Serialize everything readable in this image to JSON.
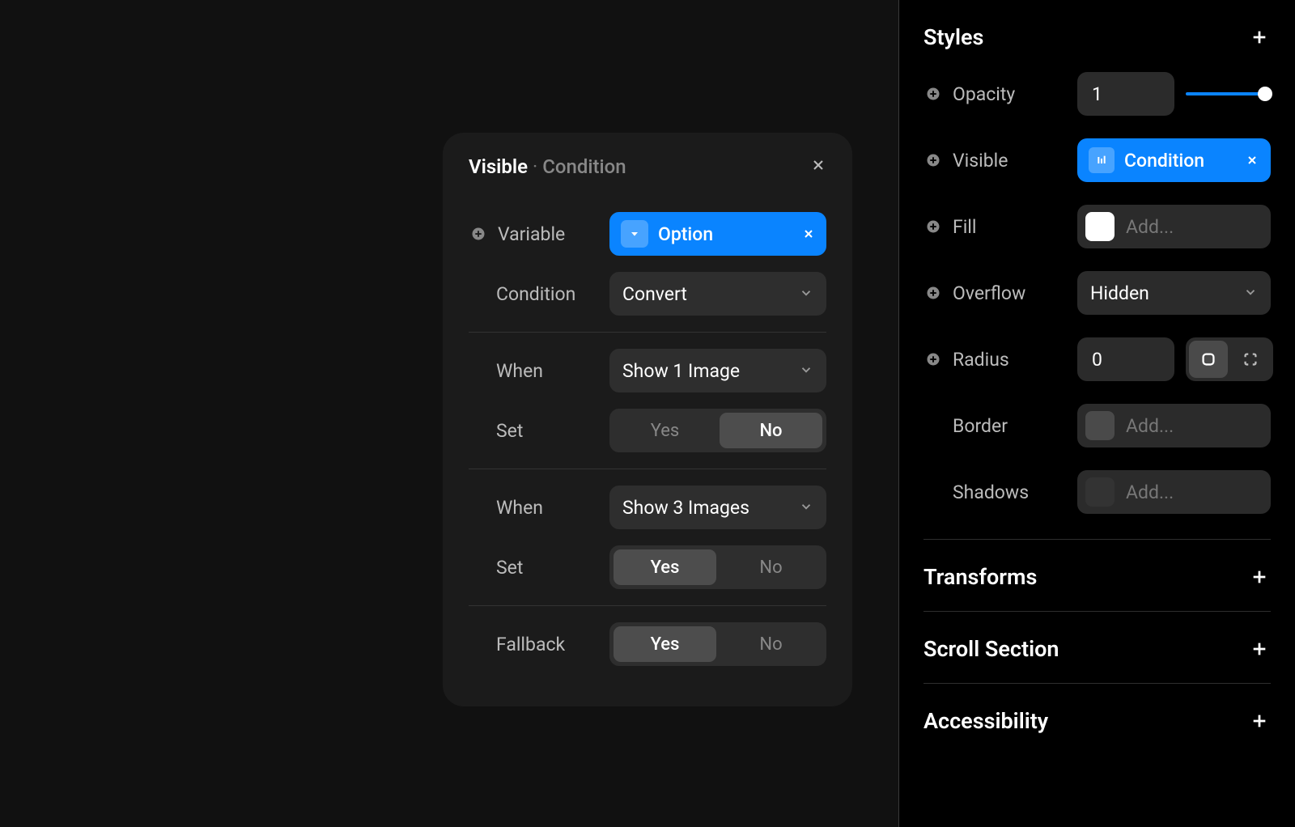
{
  "sidebar": {
    "title": "Styles",
    "opacity": {
      "label": "Opacity",
      "value": "1"
    },
    "visible": {
      "label": "Visible",
      "chip": "Condition"
    },
    "fill": {
      "label": "Fill",
      "placeholder": "Add..."
    },
    "overflow": {
      "label": "Overflow",
      "value": "Hidden"
    },
    "radius": {
      "label": "Radius",
      "value": "0"
    },
    "border": {
      "label": "Border",
      "placeholder": "Add..."
    },
    "shadows": {
      "label": "Shadows",
      "placeholder": "Add..."
    },
    "transforms": {
      "title": "Transforms"
    },
    "scroll": {
      "title": "Scroll Section"
    },
    "a11y": {
      "title": "Accessibility"
    }
  },
  "modal": {
    "title_main": "Visible",
    "title_sub": "Condition",
    "variable": {
      "label": "Variable",
      "chip": "Option"
    },
    "condition": {
      "label": "Condition",
      "value": "Convert"
    },
    "cases": [
      {
        "when_label": "When",
        "when_value": "Show 1 Image",
        "set_label": "Set",
        "yes": "Yes",
        "no": "No",
        "active": "no"
      },
      {
        "when_label": "When",
        "when_value": "Show 3 Images",
        "set_label": "Set",
        "yes": "Yes",
        "no": "No",
        "active": "yes"
      }
    ],
    "fallback": {
      "label": "Fallback",
      "yes": "Yes",
      "no": "No",
      "active": "yes"
    }
  }
}
